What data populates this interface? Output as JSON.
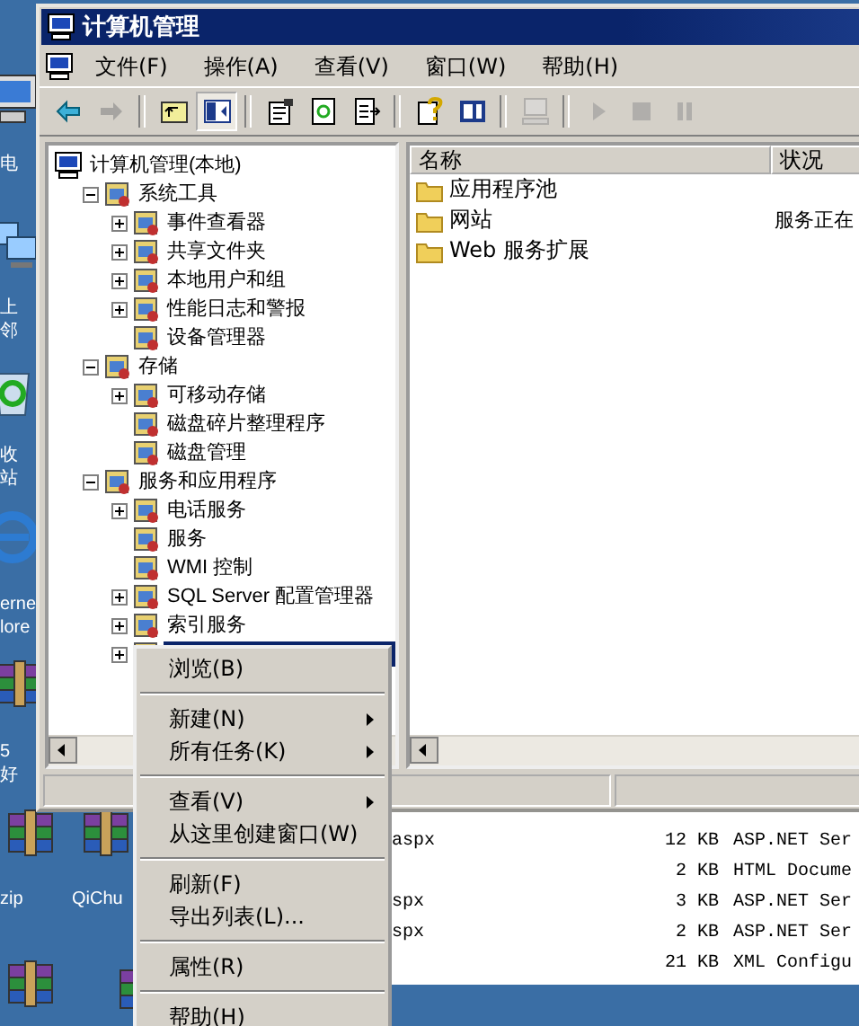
{
  "desktop_icons": [
    {
      "kind": "computer",
      "label": "电"
    },
    {
      "kind": "network",
      "label": "上邻"
    },
    {
      "kind": "recycle",
      "label": "收站"
    },
    {
      "kind": "browser",
      "label": "erne lore"
    },
    {
      "kind": "archive",
      "label": "5好"
    },
    {
      "kind": "archive",
      "label": "zip"
    },
    {
      "kind": "archive",
      "label": "QiChu"
    },
    {
      "kind": "archive"
    },
    {
      "kind": "archive"
    }
  ],
  "back_window": {
    "rows": [
      {
        "name": "aspx",
        "size": "12 KB",
        "type": "ASP.NET Ser"
      },
      {
        "size": "2 KB",
        "type": "HTML Docume"
      },
      {
        "name": "spx",
        "size": "3 KB",
        "type": "ASP.NET Ser"
      },
      {
        "name": "spx",
        "size": "2 KB",
        "type": "ASP.NET Ser"
      },
      {
        "size": "21 KB",
        "type": "XML Configu"
      }
    ]
  },
  "window": {
    "title": "计算机管理",
    "menu": [
      "文件(F)",
      "操作(A)",
      "查看(V)",
      "窗口(W)",
      "帮助(H)"
    ],
    "toolbar": [
      {
        "kind": "back",
        "disabled": false,
        "pressed": false
      },
      {
        "kind": "forward",
        "disabled": true,
        "pressed": false
      },
      {
        "kind": "separator"
      },
      {
        "kind": "up",
        "disabled": false,
        "pressed": false
      },
      {
        "kind": "tree",
        "disabled": false,
        "pressed": true
      },
      {
        "kind": "separator"
      },
      {
        "kind": "properties",
        "disabled": false,
        "pressed": false
      },
      {
        "kind": "refresh",
        "disabled": false,
        "pressed": false
      },
      {
        "kind": "export",
        "disabled": false,
        "pressed": false
      },
      {
        "kind": "separator"
      },
      {
        "kind": "help",
        "disabled": false,
        "pressed": false
      },
      {
        "kind": "action",
        "disabled": false,
        "pressed": false
      },
      {
        "kind": "separator"
      },
      {
        "kind": "computer",
        "disabled": true,
        "pressed": false
      },
      {
        "kind": "separator"
      },
      {
        "kind": "play",
        "disabled": true,
        "pressed": false
      },
      {
        "kind": "stop",
        "disabled": true,
        "pressed": false
      },
      {
        "kind": "pause",
        "disabled": true,
        "pressed": false
      }
    ],
    "tree": [
      {
        "label": "计算机管理(本地)",
        "kind": "root",
        "selected": false,
        "children": [
          {
            "label": "系统工具",
            "kind": "node",
            "expanded": true,
            "selected": false,
            "children": [
              {
                "label": "事件查看器",
                "kind": "node",
                "expanded": false,
                "selected": false
              },
              {
                "label": "共享文件夹",
                "kind": "node",
                "expanded": false,
                "selected": false
              },
              {
                "label": "本地用户和组",
                "kind": "node",
                "expanded": false,
                "selected": false
              },
              {
                "label": "性能日志和警报",
                "kind": "node",
                "expanded": false,
                "selected": false
              },
              {
                "label": "设备管理器",
                "kind": "leaf",
                "selected": false
              }
            ]
          },
          {
            "label": "存储",
            "kind": "node",
            "expanded": true,
            "selected": false,
            "children": [
              {
                "label": "可移动存储",
                "kind": "node",
                "expanded": false,
                "selected": false
              },
              {
                "label": "磁盘碎片整理程序",
                "kind": "leaf",
                "selected": false
              },
              {
                "label": "磁盘管理",
                "kind": "leaf",
                "selected": false
              }
            ]
          },
          {
            "label": "服务和应用程序",
            "kind": "node",
            "expanded": true,
            "selected": false,
            "children": [
              {
                "label": "电话服务",
                "kind": "node",
                "expanded": false,
                "selected": false
              },
              {
                "label": "服务",
                "kind": "leaf",
                "selected": false
              },
              {
                "label": "WMI 控制",
                "kind": "leaf",
                "selected": false
              },
              {
                "label": "SQL Server 配置管理器",
                "kind": "node",
                "expanded": false,
                "selected": false
              },
              {
                "label": "索引服务",
                "kind": "node",
                "expanded": false,
                "selected": false
              },
              {
                "kind": "node",
                "expanded": false,
                "selected": true
              }
            ]
          }
        ]
      }
    ],
    "list": {
      "columns": [
        "名称",
        "状况"
      ],
      "rows": [
        {
          "name": "应用程序池"
        },
        {
          "name": "网站",
          "status": "服务正在"
        },
        {
          "name": "Web 服务扩展"
        }
      ]
    }
  },
  "context_menu": [
    {
      "kind": "item",
      "label": "浏览(B)",
      "submenu": false
    },
    {
      "kind": "separator"
    },
    {
      "kind": "item",
      "label": "新建(N)",
      "submenu": true
    },
    {
      "kind": "item",
      "label": "所有任务(K)",
      "submenu": true
    },
    {
      "kind": "separator"
    },
    {
      "kind": "item",
      "label": "查看(V)",
      "submenu": true
    },
    {
      "kind": "item",
      "label": "从这里创建窗口(W)",
      "submenu": false
    },
    {
      "kind": "separator"
    },
    {
      "kind": "item",
      "label": "刷新(F)",
      "submenu": false
    },
    {
      "kind": "item",
      "label": "导出列表(L)...",
      "submenu": false
    },
    {
      "kind": "separator"
    },
    {
      "kind": "item",
      "label": "属性(R)",
      "submenu": false
    },
    {
      "kind": "separator"
    },
    {
      "kind": "item",
      "label": "帮助(H)",
      "submenu": false
    }
  ]
}
